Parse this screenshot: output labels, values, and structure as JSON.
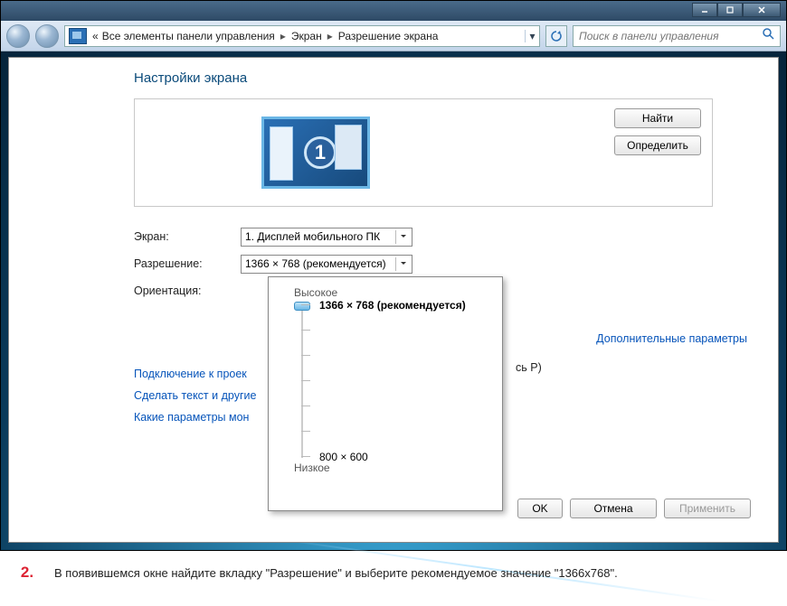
{
  "window_controls": {
    "min": "minimize",
    "max": "maximize",
    "close": "close"
  },
  "breadcrumb": {
    "prefix": "«",
    "seg1": "Все элементы панели управления",
    "seg2": "Экран",
    "seg3": "Разрешение экрана"
  },
  "search": {
    "placeholder": "Поиск в панели управления"
  },
  "page_title": "Настройки экрана",
  "monitor_number": "1",
  "buttons": {
    "find": "Найти",
    "detect": "Определить",
    "ok": "OK",
    "cancel": "Отмена",
    "apply": "Применить"
  },
  "labels": {
    "screen": "Экран:",
    "resolution": "Разрешение:",
    "orientation": "Ориентация:"
  },
  "combos": {
    "screen_value": "1. Дисплей мобильного ПК",
    "resolution_value": "1366 × 768 (рекомендуется)"
  },
  "advanced_link": "Дополнительные параметры",
  "links": {
    "projector": "Подключение к проек",
    "projector_hint": "сь P)",
    "textsize": "Сделать текст и другие",
    "which": "Какие параметры мон"
  },
  "popup": {
    "high": "Высокое",
    "low": "Низкое",
    "selected": "1366 × 768 (рекомендуется)",
    "min": "800 × 600"
  },
  "instruction": {
    "num": "2.",
    "text": "В появившемся окне найдите вкладку \"Разрешение\" и выберите рекомендуемое значение \"1366x768\"."
  }
}
